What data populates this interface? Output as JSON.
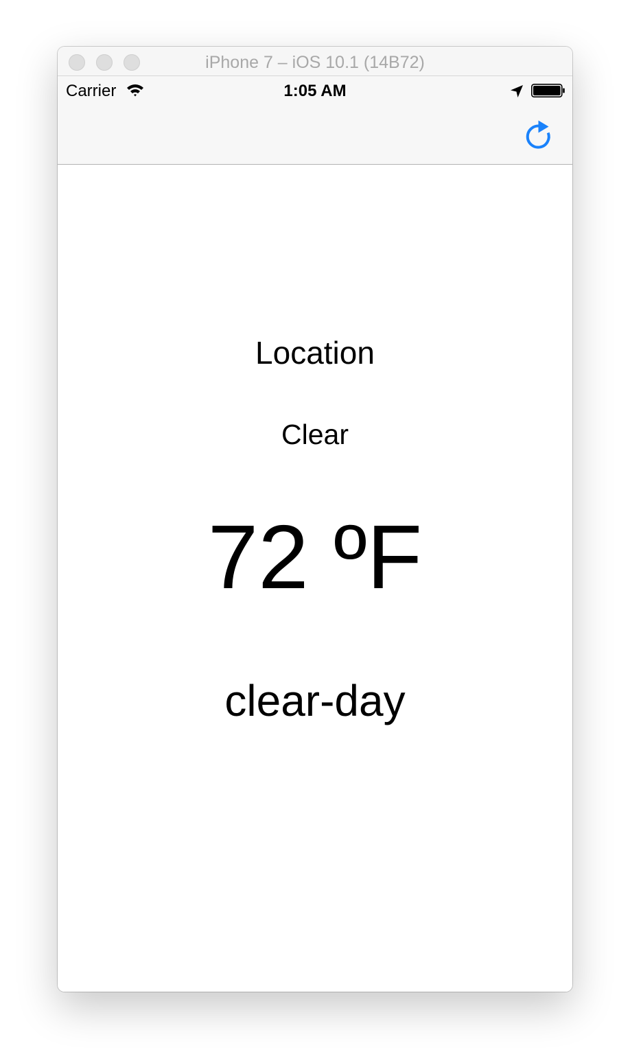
{
  "window": {
    "title": "iPhone 7 – iOS 10.1 (14B72)"
  },
  "status_bar": {
    "carrier": "Carrier",
    "time": "1:05 AM",
    "icons": [
      "wifi-icon",
      "location-arrow-icon",
      "battery-icon"
    ]
  },
  "nav_bar": {
    "right_button_icon": "refresh-icon",
    "tint_color": "#1a82fb"
  },
  "weather": {
    "location": "Location",
    "summary": "Clear",
    "temperature": "72 ºF",
    "icon": "clear-day"
  }
}
